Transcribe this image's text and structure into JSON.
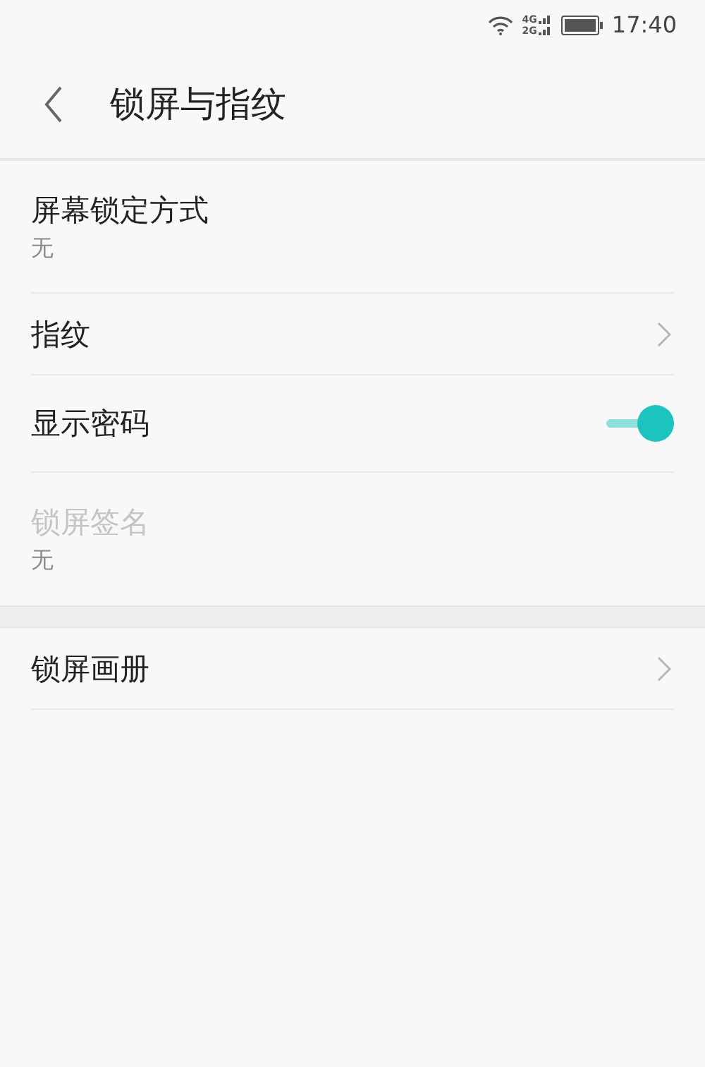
{
  "status_bar": {
    "network_top": "4G",
    "network_bottom": "2G",
    "time": "17:40"
  },
  "header": {
    "title": "锁屏与指纹"
  },
  "sections": [
    {
      "items": [
        {
          "kind": "detail",
          "title": "屏幕锁定方式",
          "subtitle": "无",
          "disabled": false
        },
        {
          "kind": "link",
          "title": "指纹",
          "disabled": false
        },
        {
          "kind": "toggle",
          "title": "显示密码",
          "on": true,
          "disabled": false
        },
        {
          "kind": "detail",
          "title": "锁屏签名",
          "subtitle": "无",
          "disabled": true
        }
      ]
    },
    {
      "items": [
        {
          "kind": "link",
          "title": "锁屏画册",
          "disabled": false
        }
      ]
    }
  ]
}
